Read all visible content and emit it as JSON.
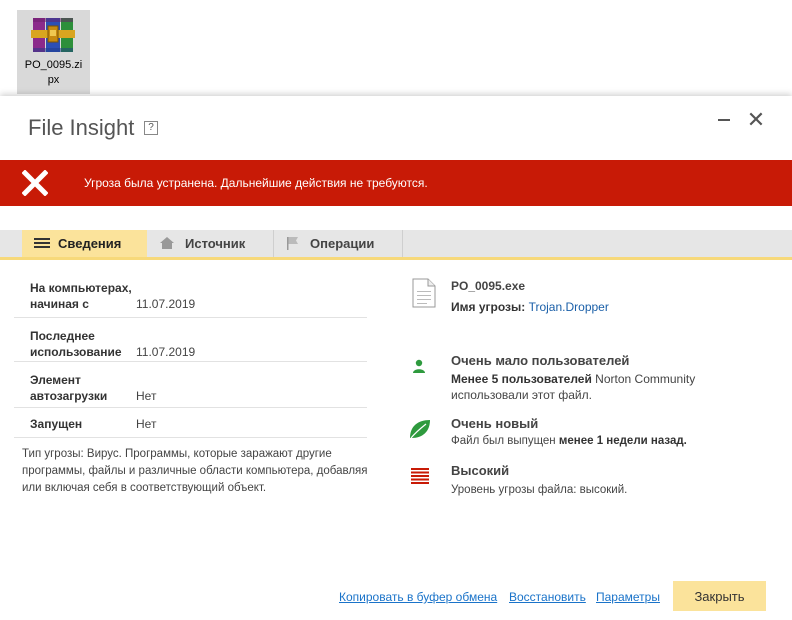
{
  "desktop": {
    "icon_label": "PO_0095.zipx"
  },
  "dialog": {
    "title": "File Insight",
    "help": "?",
    "close_glyph": "✕"
  },
  "banner": {
    "text": "Угроза была устранена. Дальнейшие действия не требуются.",
    "color": "#c81a06"
  },
  "tabs": [
    {
      "label": "Сведения",
      "icon": "list-icon",
      "active": true
    },
    {
      "label": "Источник",
      "icon": "home-icon",
      "active": false
    },
    {
      "label": "Операции",
      "icon": "flag-icon",
      "active": false
    }
  ],
  "details": [
    {
      "key_line1": "На компьютерах,",
      "key_line2": "начиная с",
      "value": "11.07.2019"
    },
    {
      "key_line1": "Последнее",
      "key_line2": "использование",
      "value": "11.07.2019"
    },
    {
      "key_line1": "Элемент",
      "key_line2": "автозагрузки",
      "value": "Нет"
    },
    {
      "key_line1": "Запущен",
      "key_line2": "",
      "value": "Нет"
    }
  ],
  "description": "Тип угрозы: Вирус. Программы, которые заражают другие программы, файлы и различные области компьютера, добавляя или включая себя в соответствующий объект.",
  "file": {
    "name": "PO_0095.exe",
    "threat_label": "Имя угрозы:",
    "threat_name": "Trojan.Dropper"
  },
  "users": {
    "title": "Очень мало пользователей",
    "bold": "Менее 5 пользователей",
    "rest1": " Norton Community",
    "line2": "использовали этот файл."
  },
  "age": {
    "title": "Очень новый",
    "prefix": "Файл был выпущен ",
    "bold": "менее 1 недели назад."
  },
  "risk": {
    "title": "Высокий",
    "text": "Уровень угрозы файла: высокий."
  },
  "footer": {
    "copy": "Копировать в буфер обмена",
    "restore": "Восстановить",
    "params": "Параметры",
    "close": "Закрыть"
  }
}
